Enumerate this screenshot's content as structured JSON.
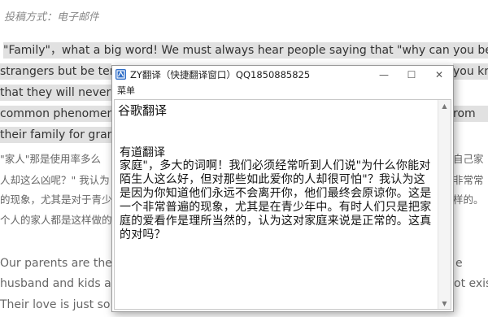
{
  "article": {
    "meta": "投稿方式：电子邮件",
    "lines": [
      "\"Family\"，what a big word! We must always hear people saying that  \"why can you be so nice to",
      "strangers but be terrible to",
      "that they will never lea",
      "common phenomenon",
      "their family for grante",
      "\"家人\"那是使用率多么",
      "人却这么凶呢？\" 我认为",
      "的现象，尤其是对于青少",
      "个人的家人都是这样做的",
      "Our parents are the m",
      "husband and kids at th",
      "Their love is just so gre"
    ],
    "right_fragments": [
      "you kno",
      "rom",
      "自己家",
      "非常常",
      "样的。"
    ],
    "right_fragment_2": "e",
    "right_fragment_3": "ot exist"
  },
  "window": {
    "title": "ZY翻译（快捷翻译窗口）QQ1850885825",
    "menu": "菜单",
    "heading1": "谷歌翻译",
    "heading2": "有道翻译",
    "body": "家庭\"，多大的词啊！我们必须经常听到人们说\"为什么你能对陌生人这么好，但对那些如此爱你的人却很可怕\"？我认为这是因为你知道他们永远不会离开你，他们最终会原谅你。这是一个非常普遍的现象，尤其是在青少年中。有时人们只是把家庭的爱看作是理所当然的，认为这对家庭来说是正常的。这真的对吗？",
    "buttons": {
      "minimize": "—",
      "maximize": "☐",
      "close": "✕"
    },
    "icon": "translate-app-icon",
    "accent": "#2f6ec9"
  }
}
